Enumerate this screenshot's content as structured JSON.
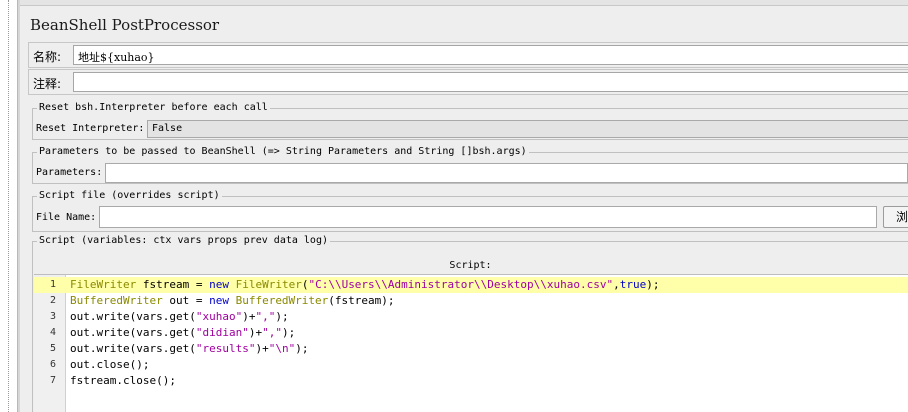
{
  "panel": {
    "title": "BeanShell PostProcessor"
  },
  "name_row": {
    "label": "名称:",
    "value": "地址${xuhao}"
  },
  "comment_row": {
    "label": "注释:",
    "value": ""
  },
  "reset_group": {
    "legend": "Reset bsh.Interpreter before each call",
    "field_label": "Reset Interpreter:",
    "selected": "False"
  },
  "params_group": {
    "legend": "Parameters to be passed to BeanShell (=> String Parameters and String []bsh.args)",
    "field_label": "Parameters:",
    "value": ""
  },
  "file_group": {
    "legend": "Script file (overrides script)",
    "field_label": "File Name:",
    "value": "",
    "browse_label": "浏览..."
  },
  "script_group": {
    "legend": "Script (variables: ctx vars props prev data log)",
    "caption": "Script:",
    "current_line": 1,
    "lines": [
      {
        "num": "1",
        "tokens": [
          {
            "t": "FileWriter",
            "c": "type"
          },
          {
            "t": " fstream = ",
            "c": "plain"
          },
          {
            "t": "new",
            "c": "kw"
          },
          {
            "t": " ",
            "c": "plain"
          },
          {
            "t": "FileWriter",
            "c": "type"
          },
          {
            "t": "(",
            "c": "plain"
          },
          {
            "t": "\"C:\\\\Users\\\\Administrator\\\\Desktop\\\\xuhao.csv\"",
            "c": "str"
          },
          {
            "t": ",",
            "c": "plain"
          },
          {
            "t": "true",
            "c": "kw"
          },
          {
            "t": ");",
            "c": "plain"
          }
        ]
      },
      {
        "num": "2",
        "tokens": [
          {
            "t": "BufferedWriter",
            "c": "type"
          },
          {
            "t": " out = ",
            "c": "plain"
          },
          {
            "t": "new",
            "c": "kw"
          },
          {
            "t": " ",
            "c": "plain"
          },
          {
            "t": "BufferedWriter",
            "c": "type"
          },
          {
            "t": "(fstream);",
            "c": "plain"
          }
        ]
      },
      {
        "num": "3",
        "tokens": [
          {
            "t": "out.write(vars.get(",
            "c": "plain"
          },
          {
            "t": "\"xuhao\"",
            "c": "str"
          },
          {
            "t": ")+",
            "c": "plain"
          },
          {
            "t": "\",\"",
            "c": "str"
          },
          {
            "t": ");",
            "c": "plain"
          }
        ]
      },
      {
        "num": "4",
        "tokens": [
          {
            "t": "out.write(vars.get(",
            "c": "plain"
          },
          {
            "t": "\"didian\"",
            "c": "str"
          },
          {
            "t": ")+",
            "c": "plain"
          },
          {
            "t": "\",\"",
            "c": "str"
          },
          {
            "t": ");",
            "c": "plain"
          }
        ]
      },
      {
        "num": "5",
        "tokens": [
          {
            "t": "out.write(vars.get(",
            "c": "plain"
          },
          {
            "t": "\"results\"",
            "c": "str"
          },
          {
            "t": ")+",
            "c": "plain"
          },
          {
            "t": "\"\\n\"",
            "c": "str"
          },
          {
            "t": ");",
            "c": "plain"
          }
        ]
      },
      {
        "num": "6",
        "tokens": [
          {
            "t": "out.close();",
            "c": "plain"
          }
        ]
      },
      {
        "num": "7",
        "tokens": [
          {
            "t": "fstream.close();",
            "c": "plain"
          }
        ]
      }
    ]
  },
  "colors": {
    "panel_bg": "#eeeeee",
    "highlight_line": "#ffffaa",
    "keyword": "#0000c8",
    "type": "#8a8a00",
    "string": "#a000a0"
  }
}
